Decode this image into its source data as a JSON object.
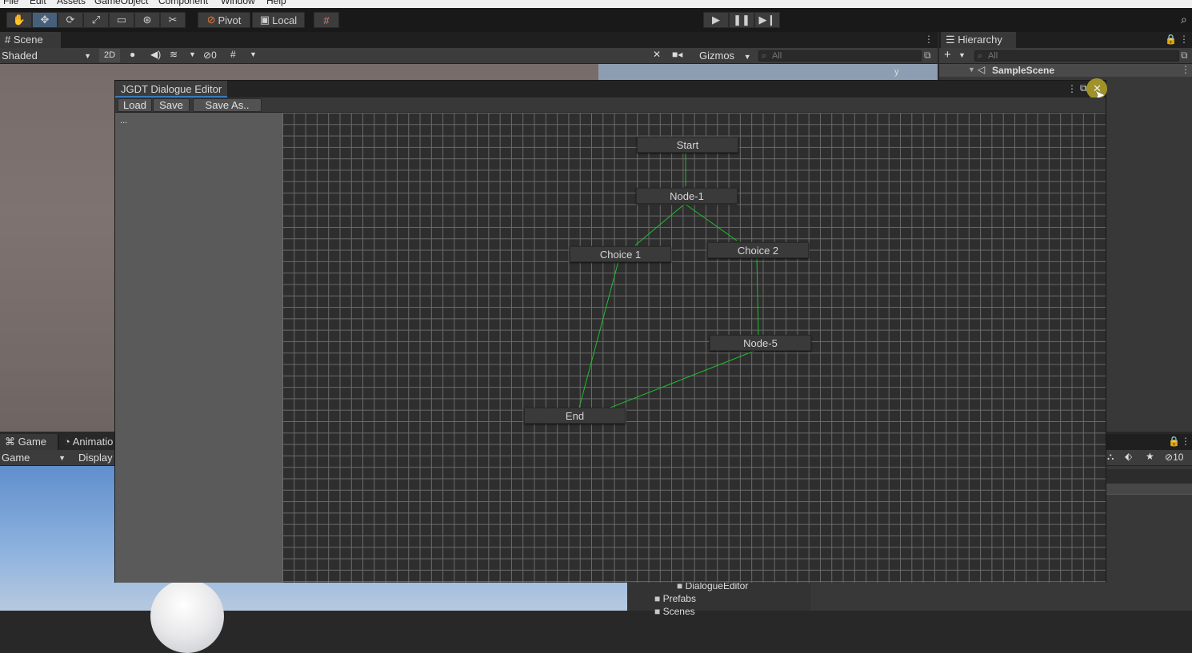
{
  "menu": [
    "File",
    "Edit",
    "Assets",
    "GameObject",
    "Component",
    "Window",
    "Help"
  ],
  "toolbar": {
    "pivot_label": "Pivot",
    "local_label": "Local"
  },
  "scene": {
    "tab_label": "Scene",
    "shading_mode": "Shaded",
    "mode_2d_label": "2D",
    "hidden_count": "0",
    "gizmos_label": "Gizmos",
    "search_placeholder": "All",
    "axis_label": "y"
  },
  "hierarchy": {
    "tab_label": "Hierarchy",
    "search_placeholder": "All",
    "scene_name": "SampleScene"
  },
  "game": {
    "tab_game_label": "Game",
    "tab_animation_label": "Animatio",
    "view_select": "Game",
    "display_label": "Display"
  },
  "project": {
    "hidden_count": "10",
    "folders": [
      "DialogueEditor",
      "Prefabs",
      "Scenes"
    ]
  },
  "editor": {
    "title": "JGDT Dialogue Editor",
    "load_label": "Load",
    "save_label": "Save",
    "save_as_label": "Save As..",
    "sidebar_text": "...",
    "nodes": [
      "Start",
      "Node-1",
      "Choice 1",
      "Choice 2",
      "Node-5",
      "End"
    ],
    "link_color": "#1fbf2f",
    "close_highlight_color": "#b5a62a"
  }
}
